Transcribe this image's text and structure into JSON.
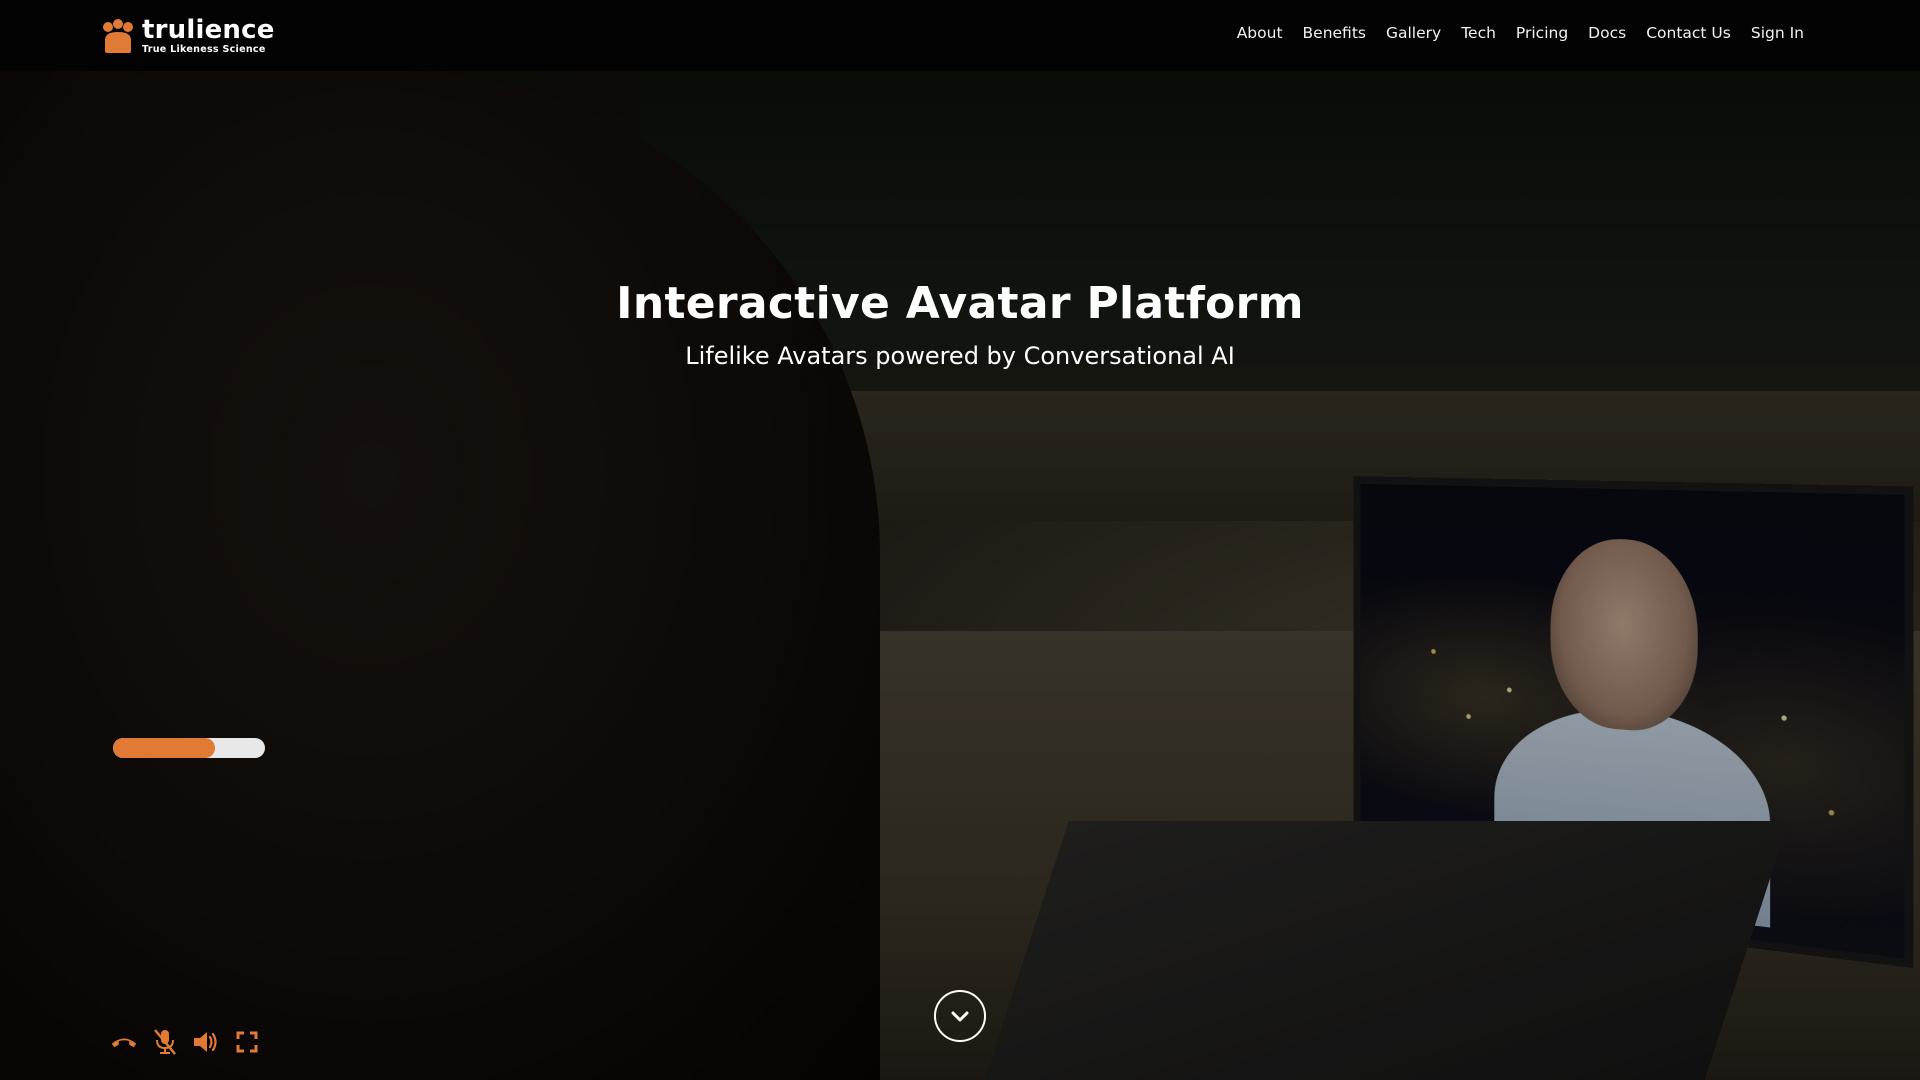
{
  "brand": {
    "name": "trulience",
    "tagline": "True Likeness Science",
    "accent_color": "#e07a35"
  },
  "nav": {
    "items": [
      {
        "label": "About"
      },
      {
        "label": "Benefits"
      },
      {
        "label": "Gallery"
      },
      {
        "label": "Tech"
      },
      {
        "label": "Pricing"
      },
      {
        "label": "Docs"
      },
      {
        "label": "Contact Us"
      },
      {
        "label": "Sign In"
      }
    ]
  },
  "hero": {
    "title": "Interactive Avatar Platform",
    "subtitle": "Lifelike Avatars powered by Conversational AI",
    "progress_percent": 67
  },
  "controls": {
    "icons": [
      "hang-up-icon",
      "mic-off-icon",
      "volume-icon",
      "fullscreen-icon"
    ]
  },
  "scroll": {
    "icon": "chevron-down-icon"
  }
}
